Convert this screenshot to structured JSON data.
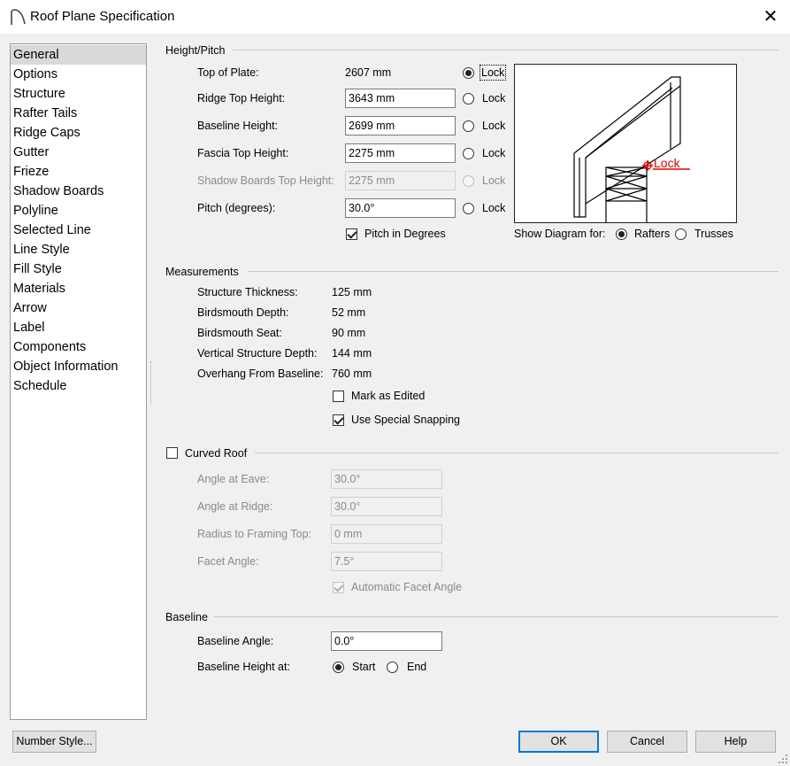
{
  "window": {
    "title": "Roof Plane Specification"
  },
  "sidebar": {
    "items": [
      {
        "label": "General",
        "selected": true
      },
      {
        "label": "Options"
      },
      {
        "label": "Structure"
      },
      {
        "label": "Rafter Tails"
      },
      {
        "label": "Ridge Caps"
      },
      {
        "label": "Gutter"
      },
      {
        "label": "Frieze"
      },
      {
        "label": "Shadow Boards"
      },
      {
        "label": "Polyline"
      },
      {
        "label": "Selected Line"
      },
      {
        "label": "Line Style"
      },
      {
        "label": "Fill Style"
      },
      {
        "label": "Materials"
      },
      {
        "label": "Arrow"
      },
      {
        "label": "Label"
      },
      {
        "label": "Components"
      },
      {
        "label": "Object Information"
      },
      {
        "label": "Schedule"
      }
    ]
  },
  "height_pitch": {
    "title": "Height/Pitch",
    "lock_label": "Lock",
    "top_of_plate": {
      "label": "Top of Plate:",
      "value": "2607 mm"
    },
    "ridge_top": {
      "label": "Ridge Top Height:",
      "value": "3643 mm"
    },
    "baseline_height": {
      "label": "Baseline Height:",
      "value": "2699 mm"
    },
    "fascia_top": {
      "label": "Fascia Top Height:",
      "value": "2275 mm"
    },
    "shadow_boards_top": {
      "label": "Shadow Boards Top Height:",
      "value": "2275 mm"
    },
    "pitch": {
      "label": "Pitch (degrees):",
      "value": "30.0°"
    },
    "pitch_in_degrees": {
      "label": "Pitch in Degrees",
      "checked": true
    },
    "diagram_lock_label": "Lock",
    "show_diagram_label": "Show Diagram for:",
    "rafters_label": "Rafters",
    "trusses_label": "Trusses",
    "diagram_accent": "#e00000"
  },
  "measurements": {
    "title": "Measurements",
    "rows": [
      {
        "label": "Structure Thickness:",
        "value": "125 mm"
      },
      {
        "label": "Birdsmouth Depth:",
        "value": "52 mm"
      },
      {
        "label": "Birdsmouth Seat:",
        "value": "90 mm"
      },
      {
        "label": "Vertical Structure Depth:",
        "value": "144 mm"
      },
      {
        "label": "Overhang From Baseline:",
        "value": "760 mm"
      }
    ],
    "mark_as_edited": {
      "label": "Mark as Edited",
      "checked": false
    },
    "special_snapping": {
      "label": "Use Special Snapping",
      "checked": true
    }
  },
  "curved_roof": {
    "title": "Curved Roof",
    "checked": false,
    "angle_eave": {
      "label": "Angle at Eave:",
      "value": "30.0°"
    },
    "angle_ridge": {
      "label": "Angle at Ridge:",
      "value": "30.0°"
    },
    "radius": {
      "label": "Radius to Framing Top:",
      "value": "0 mm"
    },
    "facet_angle": {
      "label": "Facet Angle:",
      "value": "7.5°"
    },
    "auto_facet": {
      "label": "Automatic Facet Angle",
      "checked": true
    }
  },
  "baseline": {
    "title": "Baseline",
    "angle": {
      "label": "Baseline Angle:",
      "value": "0.0°"
    },
    "height_at_label": "Baseline Height at:",
    "start_label": "Start",
    "end_label": "End"
  },
  "footer": {
    "number_style": "Number Style...",
    "ok": "OK",
    "cancel": "Cancel",
    "help": "Help"
  }
}
